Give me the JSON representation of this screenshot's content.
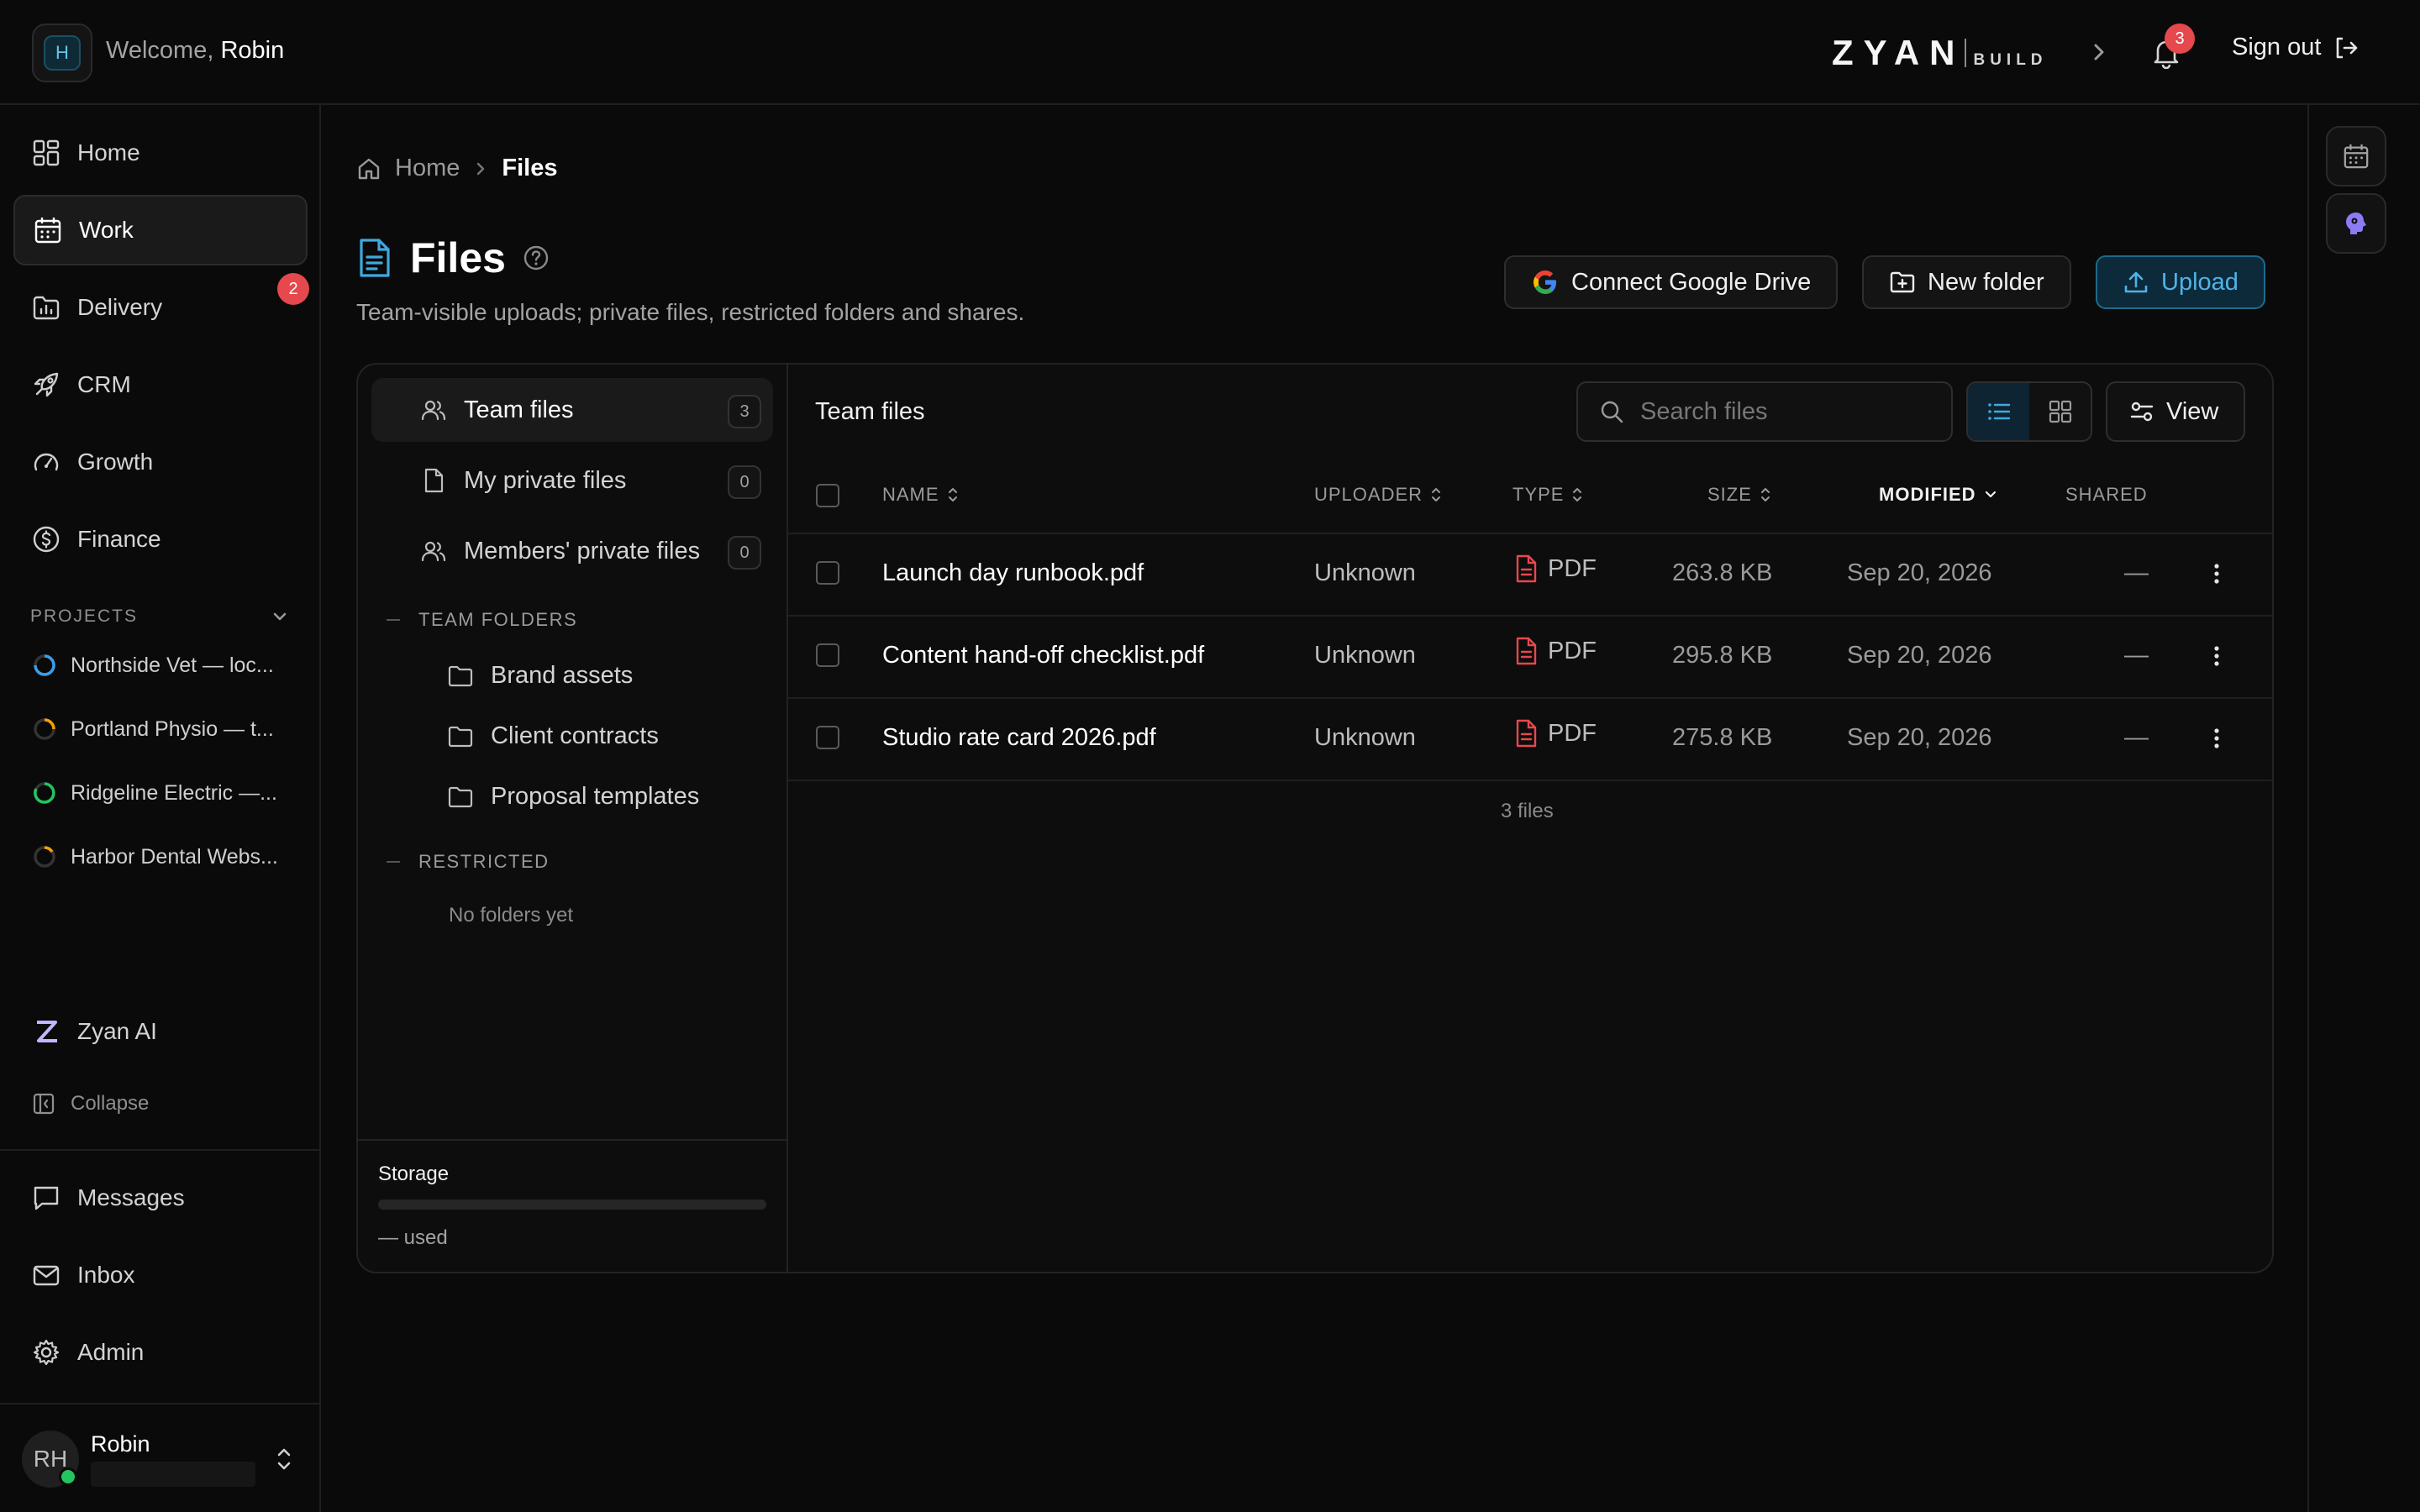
{
  "header": {
    "logo_initial": "H",
    "welcome_prefix": "Welcome,",
    "user_first_name": "Robin",
    "brand_main": "ZYAN",
    "brand_sub": "BUILD",
    "notifications_count": "3",
    "signout_label": "Sign out"
  },
  "sidebar": {
    "nav": [
      {
        "label": "Home",
        "icon": "grid-icon"
      },
      {
        "label": "Work",
        "icon": "calendar-icon",
        "active": true
      },
      {
        "label": "Delivery",
        "icon": "folder-chart-icon",
        "badge": "2"
      },
      {
        "label": "CRM",
        "icon": "rocket-icon"
      },
      {
        "label": "Growth",
        "icon": "gauge-icon"
      },
      {
        "label": "Finance",
        "icon": "dollar-icon"
      }
    ],
    "projects_label": "PROJECTS",
    "projects": [
      {
        "label": "Northside Vet — loc...",
        "color": "#3b9ee8"
      },
      {
        "label": "Portland Physio — t...",
        "color": "#f59e0b"
      },
      {
        "label": "Ridgeline Electric —...",
        "color": "#22c55e"
      },
      {
        "label": "Harbor Dental Webs...",
        "color": "#f59e0b"
      }
    ],
    "ai_label": "Zyan AI",
    "collapse_label": "Collapse",
    "secondary": [
      {
        "label": "Messages",
        "icon": "message-icon"
      },
      {
        "label": "Inbox",
        "icon": "mail-icon"
      },
      {
        "label": "Admin",
        "icon": "gear-icon"
      }
    ],
    "user": {
      "initials": "RH",
      "name": "Robin"
    }
  },
  "breadcrumb": {
    "home": "Home",
    "current": "Files"
  },
  "page": {
    "title": "Files",
    "subtitle": "Team-visible uploads; private files, restricted folders and shares.",
    "actions": {
      "connect_drive": "Connect Google Drive",
      "new_folder": "New folder",
      "upload": "Upload"
    }
  },
  "folders": {
    "items": [
      {
        "label": "Team files",
        "count": "3",
        "active": true
      },
      {
        "label": "My private files",
        "count": "0"
      },
      {
        "label": "Members' private files",
        "count": "0"
      }
    ],
    "team_folders_label": "TEAM FOLDERS",
    "team_folders": [
      "Brand assets",
      "Client contracts",
      "Proposal templates"
    ],
    "restricted_label": "RESTRICTED",
    "restricted_empty": "No folders yet",
    "storage_label": "Storage",
    "storage_used": "— used"
  },
  "list": {
    "title": "Team files",
    "search_placeholder": "Search files",
    "view_label": "View",
    "columns": {
      "name": "NAME",
      "uploader": "UPLOADER",
      "type": "TYPE",
      "size": "SIZE",
      "modified": "MODIFIED",
      "shared": "SHARED"
    },
    "rows": [
      {
        "name": "Launch day runbook.pdf",
        "uploader": "Unknown",
        "type": "PDF",
        "size": "263.8 KB",
        "modified": "Sep 20, 2026",
        "shared": "—"
      },
      {
        "name": "Content hand-off checklist.pdf",
        "uploader": "Unknown",
        "type": "PDF",
        "size": "295.8 KB",
        "modified": "Sep 20, 2026",
        "shared": "—"
      },
      {
        "name": "Studio rate card 2026.pdf",
        "uploader": "Unknown",
        "type": "PDF",
        "size": "275.8 KB",
        "modified": "Sep 20, 2026",
        "shared": "—"
      }
    ],
    "footer": "3 files"
  },
  "colors": {
    "accent": "#4fb3e6",
    "danger": "#e5484d",
    "pdf": "#e5484d",
    "online": "#22c55e"
  }
}
